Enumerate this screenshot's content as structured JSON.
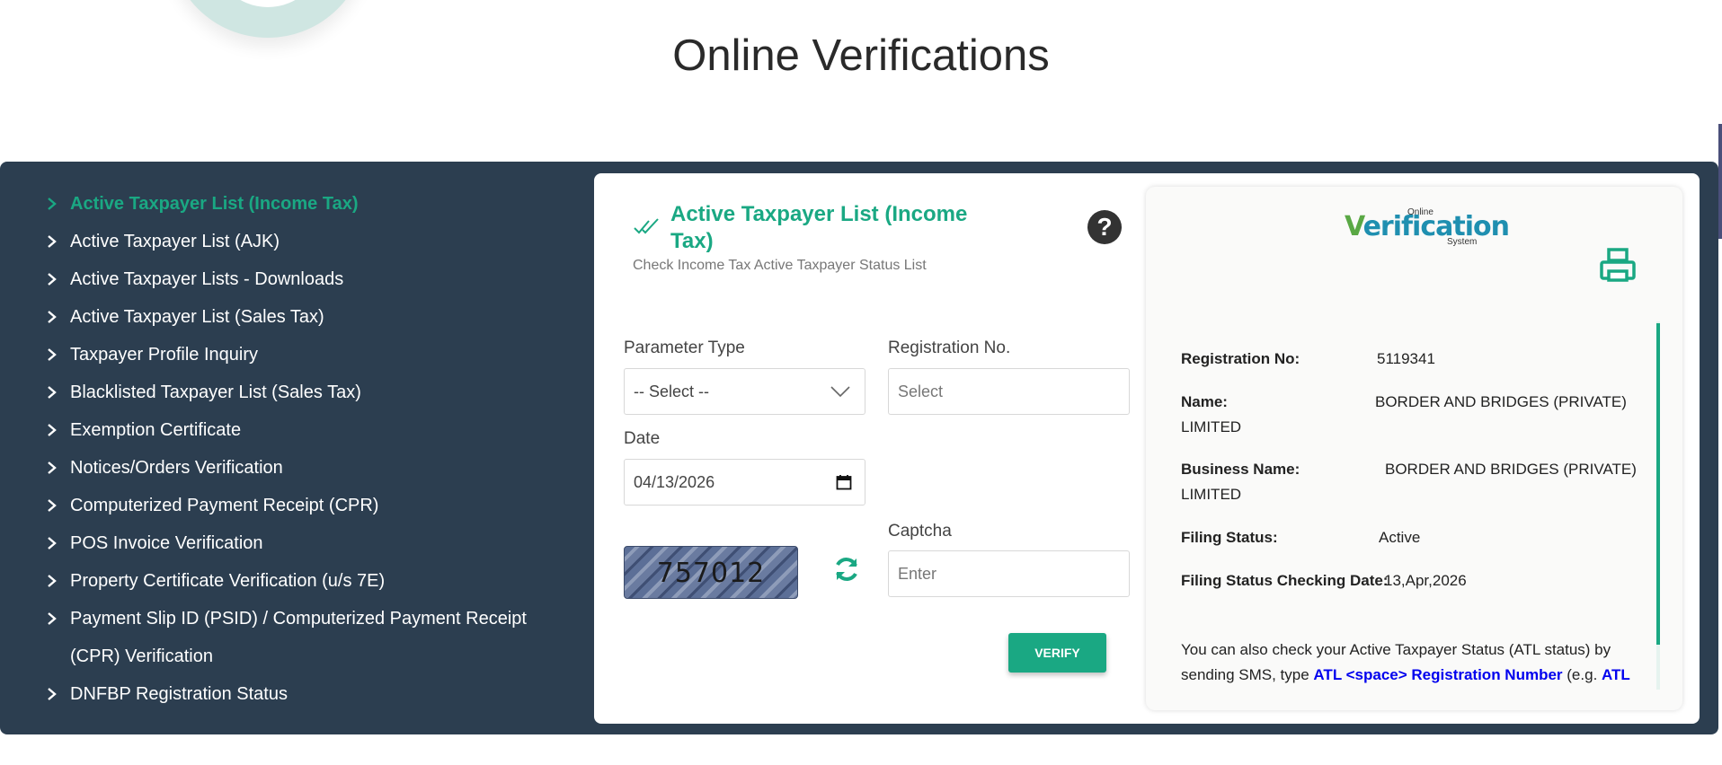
{
  "page": {
    "title": "Online Verifications"
  },
  "sidebar": {
    "items": [
      {
        "label": "Active Taxpayer List (Income Tax)",
        "active": true
      },
      {
        "label": "Active Taxpayer List (AJK)"
      },
      {
        "label": "Active Taxpayer Lists - Downloads"
      },
      {
        "label": "Active Taxpayer List (Sales Tax)"
      },
      {
        "label": "Taxpayer Profile Inquiry"
      },
      {
        "label": "Blacklisted Taxpayer List (Sales Tax)"
      },
      {
        "label": "Exemption Certificate"
      },
      {
        "label": "Notices/Orders Verification"
      },
      {
        "label": "Computerized Payment Receipt (CPR)"
      },
      {
        "label": "POS Invoice Verification"
      },
      {
        "label": "Property Certificate Verification (u/s 7E)"
      },
      {
        "label": "Payment Slip ID (PSID) / Computerized Payment Receipt (CPR) Verification"
      },
      {
        "label": "DNFBP Registration Status"
      }
    ]
  },
  "form": {
    "title": "Active Taxpayer List (Income Tax)",
    "subtitle": "Check Income Tax Active Taxpayer Status List",
    "help_symbol": "?",
    "parameter_type_label": "Parameter Type",
    "parameter_type_value": "-- Select --",
    "registration_label": "Registration No.",
    "registration_placeholder": "Select",
    "date_label": "Date",
    "date_value": "04/13/2026",
    "captcha_label": "Captcha",
    "captcha_code": "757012",
    "captcha_placeholder": "Enter",
    "verify_label": "VERIFY"
  },
  "result": {
    "logo_top": "Online",
    "logo_v": "V",
    "logo_main": "erification",
    "logo_bottom": "System",
    "reg_key": "Registration No:",
    "reg_value": "5119341",
    "name_key": "Name:",
    "name_value": "BORDER AND BRIDGES (PRIVATE)",
    "name_value_cont": "LIMITED",
    "business_key": "Business Name:",
    "business_value": "BORDER AND BRIDGES (PRIVATE)",
    "business_value_cont": "LIMITED",
    "filing_key": "Filing Status:",
    "filing_value": "Active",
    "check_date_key": "Filing Status Checking Date:",
    "check_date_value": "13,Apr,2026",
    "sms_line1": "You can also check your Active Taxpayer Status (ATL status) by",
    "sms_line2_a": "sending SMS, type ",
    "sms_line2_b": "ATL <space> Registration Number",
    "sms_line2_c": " (e.g. ",
    "sms_line2_d": "ATL"
  },
  "colors": {
    "accent": "#1aa883",
    "panel": "#2c3e50"
  },
  "icons": [
    "chevron-right-icon",
    "double-check-icon",
    "help-icon",
    "chevron-down-icon",
    "calendar-icon",
    "refresh-icon",
    "printer-icon"
  ]
}
